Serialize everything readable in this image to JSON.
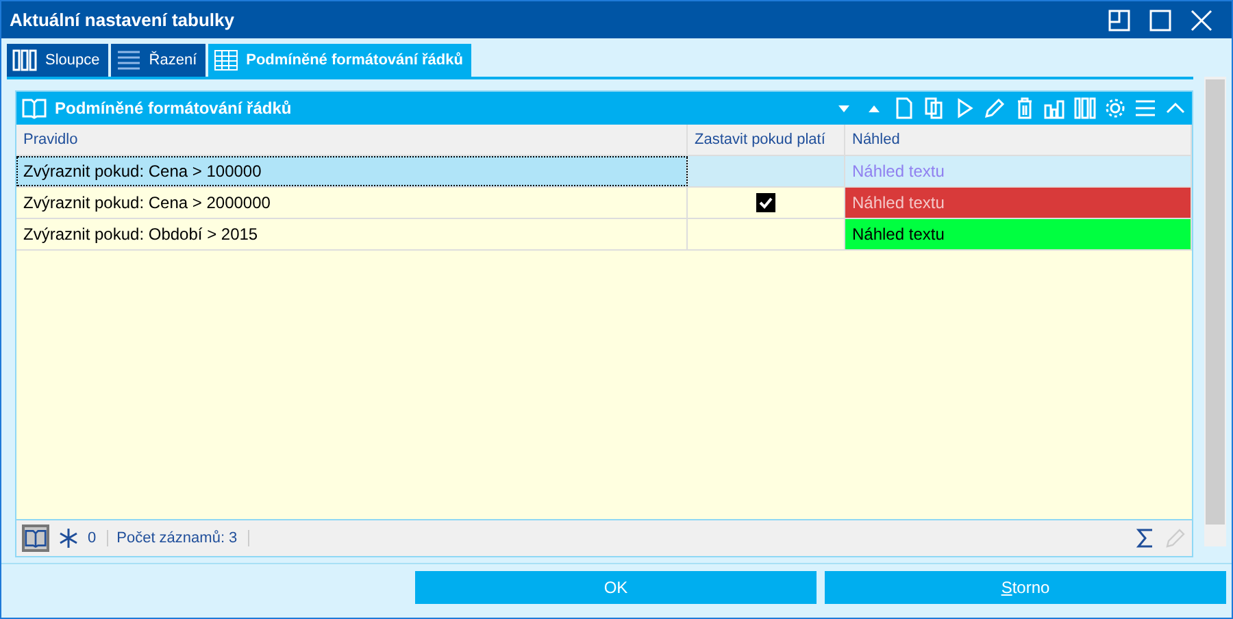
{
  "window": {
    "title": "Aktuální nastavení tabulky"
  },
  "tabs": [
    {
      "label": "Sloupce",
      "selected": false
    },
    {
      "label": "Řazení",
      "selected": false
    },
    {
      "label": "Podmíněné formátování řádků",
      "selected": true
    }
  ],
  "panel": {
    "title": "Podmíněné formátování řádků"
  },
  "table": {
    "columns": [
      "Pravidlo",
      "Zastavit pokud platí",
      "Náhled"
    ],
    "rows": [
      {
        "rule": "Zvýraznit pokud: Cena > 100000",
        "stop": false,
        "selected": true,
        "preview": {
          "text": "Náhled textu",
          "color": "#d0eefa",
          "font": {
            "color": "#9080f0"
          }
        }
      },
      {
        "rule": "Zvýraznit pokud: Cena > 2000000",
        "stop": true,
        "selected": false,
        "preview": {
          "text": "Náhled textu",
          "color": "#d83a3a",
          "font": {
            "color": "#f4c8c8"
          }
        }
      },
      {
        "rule": "Zvýraznit pokud: Období > 2015",
        "stop": false,
        "selected": false,
        "preview": {
          "text": "Náhled textu",
          "color": "#00ff40",
          "font": {
            "color": "#000000"
          }
        }
      }
    ]
  },
  "status_bar": {
    "book_active": true,
    "frozen": "0",
    "count": "Počet záznamů: 3"
  },
  "buttons": [
    {
      "label": "OK",
      "mnemonic": false
    },
    {
      "label": "Storno",
      "mnemonic": true
    }
  ]
}
